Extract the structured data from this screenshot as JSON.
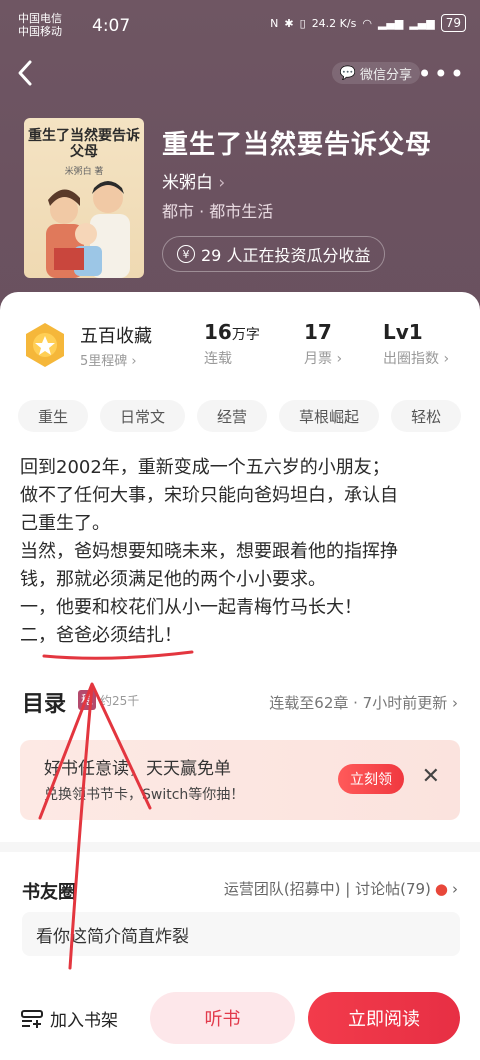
{
  "status_bar": {
    "carrier1": "中国电信",
    "carrier2": "中国移动",
    "time": "4:07",
    "speed": "24.2 K/s",
    "battery": "79"
  },
  "nav": {
    "share_label": "微信分享",
    "more_label": "•••"
  },
  "book": {
    "cover_title": "重生了当然要告诉父母",
    "cover_author": "米粥白 著",
    "title": "重生了当然要告诉父母",
    "author": "米粥白",
    "genre": "都市 · 都市生活",
    "invest_text": "29 人正在投资瓜分收益"
  },
  "stats": {
    "collection": "五百收藏",
    "milestone": "5里程碑",
    "words_value": "16",
    "words_unit": "万字",
    "words_label": "连载",
    "tickets_value": "17",
    "tickets_label": "月票",
    "level_value": "Lv1",
    "level_label": "出圈指数"
  },
  "tags": [
    "重生",
    "日常文",
    "经营",
    "草根崛起",
    "轻松"
  ],
  "synopsis": [
    "回到2002年，重新变成一个五六岁的小朋友；",
    "做不了任何大事，宋玠只能向爸妈坦白，承认自",
    "己重生了。",
    "当然，爸妈想要知晓未来，想要跟着他的指挥挣",
    "钱，那就必须满足他的两个小小要求。",
    "一，他要和校花们从小一起青梅竹马长大！",
    "二，爸爸必须结扎！"
  ],
  "toc": {
    "title": "目录",
    "badge": "稳",
    "count": "约25千",
    "info": "连载至62章 · 7小时前更新"
  },
  "promo": {
    "line1": "好书任意读，天天赢免单",
    "line2": "兑换领书节卡，Switch等你抽！",
    "button": "立刻领"
  },
  "circle": {
    "title": "书友圈",
    "info": "运营团队(招募中) | 讨论帖(79)",
    "comment": "看你这简介简直炸裂"
  },
  "bottom": {
    "shelf": "加入书架",
    "listen": "听书",
    "read": "立即阅读"
  },
  "colors": {
    "hero": "#6f5663",
    "accent": "#e72f44",
    "annotation": "#e3363f"
  }
}
